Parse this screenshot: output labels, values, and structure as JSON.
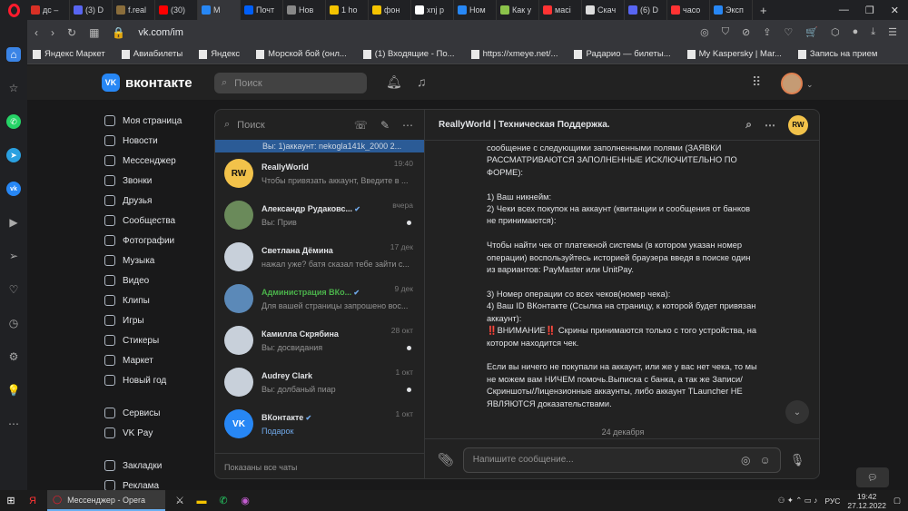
{
  "browser": {
    "tabs": [
      {
        "label": "дс –",
        "color": "#d93025"
      },
      {
        "label": "(3) D",
        "color": "#5865f2"
      },
      {
        "label": "f.real",
        "color": "#8a6d3b"
      },
      {
        "label": "(30)",
        "color": "#ff0000"
      },
      {
        "label": "М",
        "color": "#2787f5",
        "active": true
      },
      {
        "label": "Почт",
        "color": "#005ff9"
      },
      {
        "label": "Нов",
        "color": "#888888"
      },
      {
        "label": "1 ho",
        "color": "#f5c400"
      },
      {
        "label": "фон",
        "color": "#f5c400"
      },
      {
        "label": "xnj p",
        "color": "#ffffff"
      },
      {
        "label": "Ном",
        "color": "#2787f5"
      },
      {
        "label": "Как у",
        "color": "#8bc34a"
      },
      {
        "label": "масі",
        "color": "#ff3333"
      },
      {
        "label": "Скач",
        "color": "#dddddd"
      },
      {
        "label": "(6) D",
        "color": "#5865f2"
      },
      {
        "label": "часо",
        "color": "#ff3333"
      },
      {
        "label": "Эксп",
        "color": "#2787f5"
      }
    ],
    "url": "vk.com/im",
    "bookmarks": [
      "Яндекс Маркет",
      "Авиабилеты",
      "Яндекс",
      "Морской бой (онл...",
      "(1) Входящие - По...",
      "https://xmeye.net/...",
      "Радарио — билеты...",
      "My Kaspersky | Маr...",
      "Запись на прием"
    ]
  },
  "vk": {
    "logo": "вконтакте",
    "logo_mark": "VK",
    "search_placeholder": "Поиск",
    "menu": [
      "Моя страница",
      "Новости",
      "Мессенджер",
      "Звонки",
      "Друзья",
      "Сообщества",
      "Фотографии",
      "Музыка",
      "Видео",
      "Клипы",
      "Игры",
      "Стикеры",
      "Маркет",
      "Новый год"
    ],
    "menu2": [
      "Сервисы",
      "VK Pay"
    ],
    "menu3": [
      "Закладки",
      "Реклама"
    ]
  },
  "messenger": {
    "search_placeholder": "Поиск",
    "active_preview": "Вы: 1)аккаунт: nekogla141k_2000 2...",
    "conversations": [
      {
        "name": "ReallyWorld",
        "preview": "Чтобы привязать аккаунт, Введите в ...",
        "time": "19:40",
        "avatar": "RW",
        "avatar_color": "#f2c24a",
        "dot": false
      },
      {
        "name": "Александр Рудаковс...",
        "preview": "Вы: Прив",
        "time": "вчера",
        "avatar": "",
        "avatar_color": "#6a8a5a",
        "dot": true,
        "verified": true
      },
      {
        "name": "Светлана Дёмина",
        "preview": "нажал уже? батя сказал тебе зайти с...",
        "time": "17 дек",
        "avatar": "",
        "avatar_color": "#c8d0da",
        "dot": false
      },
      {
        "name": "Администрация ВКо...",
        "preview": "Для вашей страницы запрошено вос...",
        "time": "9 дек",
        "avatar": "",
        "avatar_color": "#5b89b8",
        "dot": false,
        "green": true,
        "verified": true
      },
      {
        "name": "Камилла Скрябина",
        "preview": "Вы: досвидания",
        "time": "28 окт",
        "avatar": "",
        "avatar_color": "#c8d0da",
        "dot": true
      },
      {
        "name": "Audrey Clark",
        "preview": "Вы: долбаный пиар",
        "time": "1 окт",
        "avatar": "",
        "avatar_color": "#c8d0da",
        "dot": true
      },
      {
        "name": "ВКонтакте",
        "preview": "Подарок",
        "time": "1 окт",
        "avatar": "VK",
        "avatar_color": "#2787f5",
        "dot": false,
        "verified": true,
        "blue_preview": true
      }
    ],
    "footer": "Показаны все чаты",
    "chat_title": "ReallyWorld | Техническая Поддержка.",
    "chat_avatar": "RW",
    "message": "сообщение с следующими заполненными полями (ЗАЯВКИ РАССМАТРИВАЮТСЯ ЗАПОЛНЕННЫЕ ИСКЛЮЧИТЕЛЬНО ПО ФОРМЕ):\n\n1) Ваш никнейм:\n2) Чеки всех покупок на аккаунт (квитанции и сообщения от банков не принимаются):\n\nЧтобы найти чек от платежной системы (в котором указан номер операции) воспользуйтесь историей браузера введя в поиске один из вариантов: PayMaster или UnitPay.\n\n3) Номер операции со всех чеков(номер чека):\n4) Ваш ID ВКонтакте (Ссылка на страницу, к которой будет привязан аккаунт):\n‼️ВНИМАНИЕ‼️ Скрины принимаются только с того устройства, на котором находится чек.\n\nЕсли вы ничего не покупали на аккаунт, или же у вас нет чека, то мы не можем вам НИЧЕМ помочь.Выписка с банка, а так же Записи/Скриншоты/Лицензионные аккаунты, либо аккаунт TLauncher НЕ ЯВЛЯЮТСЯ доказательствами.",
    "date_sep": "24 декабря",
    "composer_placeholder": "Напишите сообщение..."
  },
  "taskbar": {
    "app": "Мессенджер - Opera",
    "lang": "РУС",
    "time": "19:42",
    "date": "27.12.2022"
  }
}
